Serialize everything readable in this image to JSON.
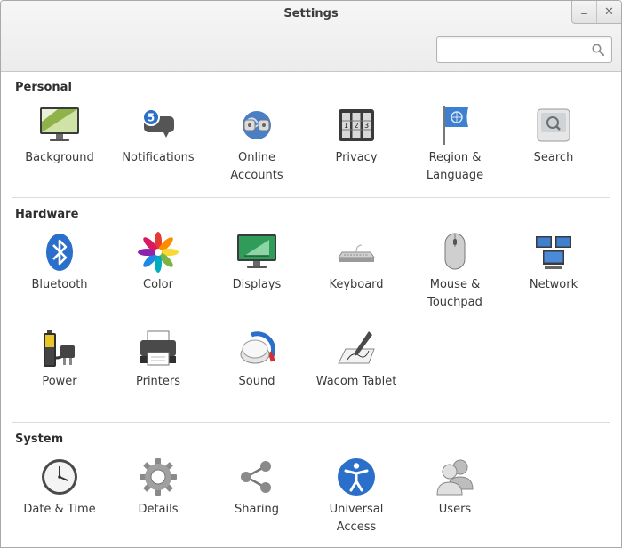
{
  "window": {
    "title": "Settings",
    "minimize_glyph": "_",
    "close_glyph": "✕"
  },
  "search": {
    "placeholder": "",
    "value": "",
    "icon": "magnifier-icon"
  },
  "sections": {
    "personal": {
      "title": "Personal",
      "items": [
        {
          "label": "Background",
          "icon": "background-icon"
        },
        {
          "label": "Notifications",
          "icon": "notifications-icon",
          "badge": "5"
        },
        {
          "label": "Online Accounts",
          "icon": "online-accounts-icon"
        },
        {
          "label": "Privacy",
          "icon": "privacy-icon"
        },
        {
          "label": "Region & Language",
          "icon": "region-language-icon"
        },
        {
          "label": "Search",
          "icon": "search-settings-icon"
        }
      ]
    },
    "hardware": {
      "title": "Hardware",
      "items": [
        {
          "label": "Bluetooth",
          "icon": "bluetooth-icon"
        },
        {
          "label": "Color",
          "icon": "color-icon"
        },
        {
          "label": "Displays",
          "icon": "displays-icon"
        },
        {
          "label": "Keyboard",
          "icon": "keyboard-icon"
        },
        {
          "label": "Mouse & Touchpad",
          "icon": "mouse-touchpad-icon"
        },
        {
          "label": "Network",
          "icon": "network-icon"
        },
        {
          "label": "Power",
          "icon": "power-icon"
        },
        {
          "label": "Printers",
          "icon": "printers-icon"
        },
        {
          "label": "Sound",
          "icon": "sound-icon"
        },
        {
          "label": "Wacom Tablet",
          "icon": "wacom-tablet-icon"
        }
      ]
    },
    "system": {
      "title": "System",
      "items": [
        {
          "label": "Date & Time",
          "icon": "clock-icon"
        },
        {
          "label": "Details",
          "icon": "details-gear-icon"
        },
        {
          "label": "Sharing",
          "icon": "sharing-icon"
        },
        {
          "label": "Universal Access",
          "icon": "universal-access-icon"
        },
        {
          "label": "Users",
          "icon": "users-icon"
        }
      ]
    }
  },
  "colors": {
    "accent_blue": "#2a6fc9",
    "title_text": "#3c3c3c",
    "label_text": "#3a3a3a",
    "divider": "#dcdcdc"
  }
}
